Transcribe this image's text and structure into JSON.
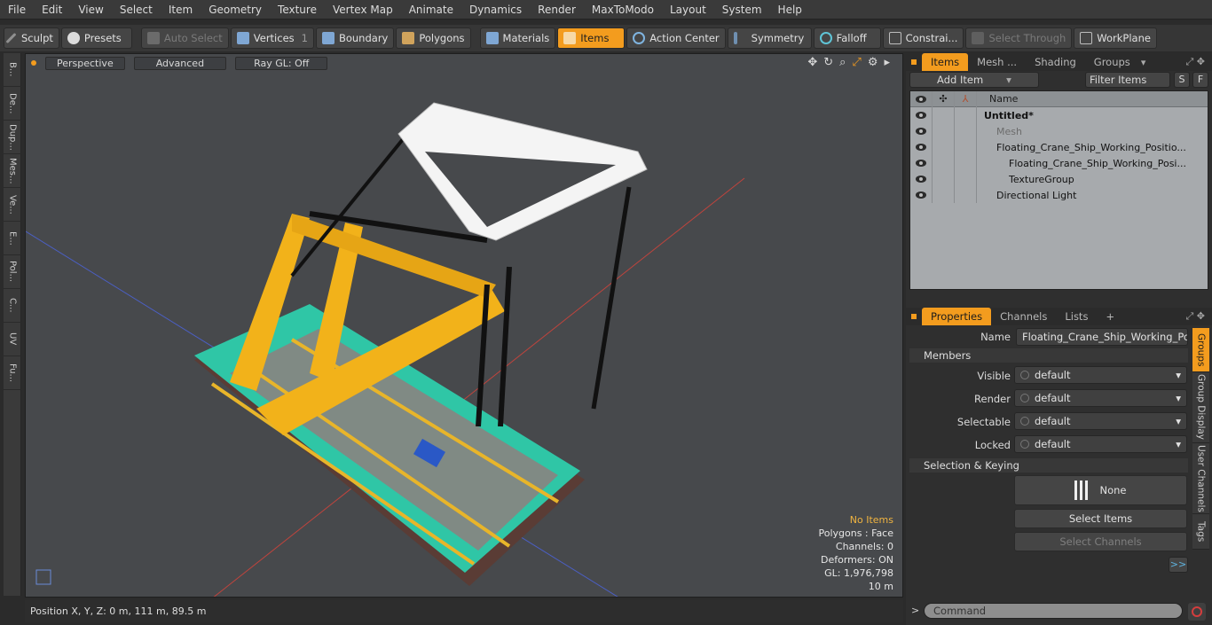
{
  "menubar": [
    "File",
    "Edit",
    "View",
    "Select",
    "Item",
    "Geometry",
    "Texture",
    "Vertex Map",
    "Animate",
    "Dynamics",
    "Render",
    "MaxToModo",
    "Layout",
    "System",
    "Help"
  ],
  "toolbar": {
    "sculpt": "Sculpt",
    "presets": "Presets",
    "auto_select": "Auto Select",
    "vertices": "Vertices",
    "vertices_count": "1",
    "boundary": "Boundary",
    "polygons": "Polygons",
    "materials": "Materials",
    "items": "Items",
    "action_center": "Action Center",
    "symmetry": "Symmetry",
    "falloff": "Falloff",
    "constraints": "Constrai...",
    "select_through": "Select Through",
    "workplane": "WorkPlane"
  },
  "left_tabs": [
    "B...",
    "De...",
    "Dup...",
    "Mes...",
    "Ve...",
    "E...",
    "Pol...",
    "C...",
    "UV",
    "Fu..."
  ],
  "viewport": {
    "view_mode": "Perspective",
    "shading": "Advanced",
    "raygl": "Ray GL: Off",
    "info": {
      "no_items": "No Items",
      "polygons": "Polygons : Face",
      "channels": "Channels: 0",
      "deformers": "Deformers: ON",
      "gl": "GL: 1,976,798",
      "scale": "10 m"
    }
  },
  "status": {
    "position": "Position X, Y, Z:   0 m, 111 m, 89.5 m"
  },
  "items_panel": {
    "tabs": [
      "Items",
      "Mesh ...",
      "Shading",
      "Groups"
    ],
    "add_item": "Add Item",
    "filter": "Filter Items",
    "s": "S",
    "f": "F",
    "name_header": "Name",
    "tree": [
      {
        "label": "Untitled*",
        "indent": 0
      },
      {
        "label": "Mesh",
        "indent": 1
      },
      {
        "label": "Floating_Crane_Ship_Working_Positio...",
        "indent": 1
      },
      {
        "label": "Floating_Crane_Ship_Working_Posi...",
        "indent": 2
      },
      {
        "label": "TextureGroup",
        "indent": 2
      },
      {
        "label": "Directional Light",
        "indent": 1
      }
    ]
  },
  "properties_panel": {
    "tabs": [
      "Properties",
      "Channels",
      "Lists",
      "+"
    ],
    "name_label": "Name",
    "name_value": "Floating_Crane_Ship_Working_Positio",
    "members": "Members",
    "visible_label": "Visible",
    "render_label": "Render",
    "selectable_label": "Selectable",
    "locked_label": "Locked",
    "default": "default",
    "selection_keying": "Selection & Keying",
    "none": "None",
    "select_items": "Select Items",
    "select_channels": "Select Channels",
    "more": ">>",
    "side_tabs": [
      "Groups",
      "Group Display",
      "User Channels",
      "Tags"
    ]
  },
  "command": "Command",
  "colors": {
    "accent": "#f39c1e",
    "viewport_bg": "#47494c"
  }
}
